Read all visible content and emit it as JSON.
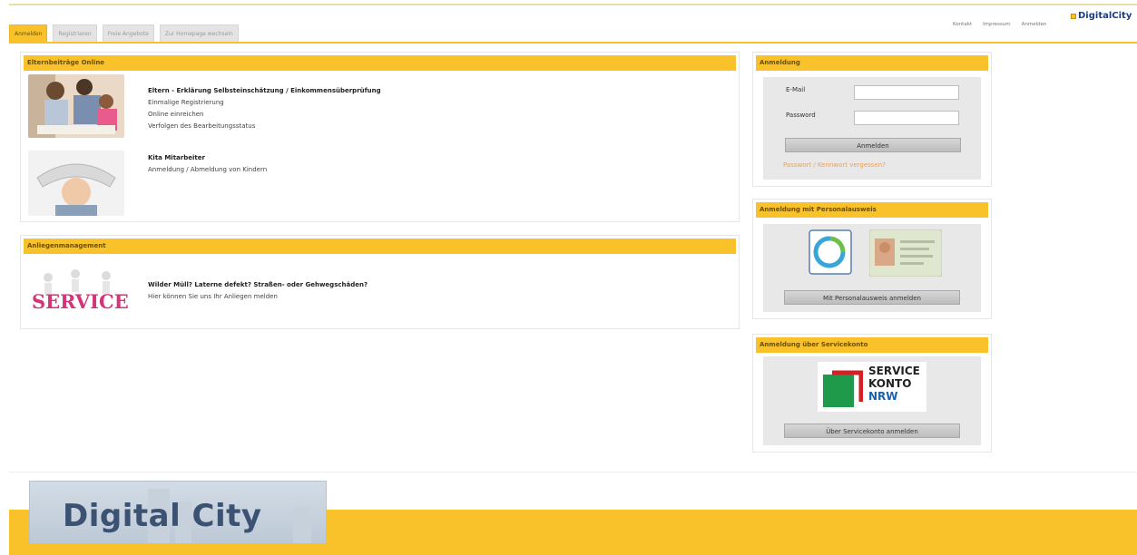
{
  "tabs": [
    {
      "label": "Anmelden",
      "active": true
    },
    {
      "label": "Registrieren",
      "active": false
    },
    {
      "label": "Freie Angebote",
      "active": false
    },
    {
      "label": "Zur Homepage wechseln",
      "active": false
    }
  ],
  "top_links": [
    "Kontakt",
    "Impressum",
    "Anmelden"
  ],
  "brand": "DigitalCity",
  "eltern_panel": {
    "title": "Elternbeiträge Online",
    "item1": {
      "title": "Eltern - Erklärung Selbsteinschätzung / Einkommensüberprüfung",
      "lines": [
        "Einmalige Registrierung",
        "Online einreichen",
        "Verfolgen des Bearbeitungsstatus"
      ]
    },
    "item2": {
      "title": "Kita Mitarbeiter",
      "lines": [
        "Anmeldung / Abmeldung von Kindern"
      ]
    }
  },
  "anliegen_panel": {
    "title": "Anliegenmanagement",
    "item": {
      "title": "Wilder Müll? Laterne defekt? Straßen- oder Gehwegschäden?",
      "lines": [
        "Hier können Sie uns Ihr Anliegen melden"
      ],
      "image_text": "SERVICE"
    }
  },
  "login_panel": {
    "title": "Anmeldung",
    "email_label": "E-Mail",
    "password_label": "Password",
    "email_value": "",
    "password_value": "",
    "submit_label": "Anmelden",
    "forgot_label": "Passwort / Kennwort vergessen?"
  },
  "ausweis_panel": {
    "title": "Anmeldung mit Personalausweis",
    "button_label": "Mit Personalausweis anmelden"
  },
  "servicekonto_panel": {
    "title": "Anmeldung über Servicekonto",
    "logo_lines": [
      "SERVICE",
      "KONTO",
      "NRW"
    ],
    "button_label": "Über Servicekonto anmelden"
  },
  "footer": {
    "logo_text": "Digital City"
  },
  "colors": {
    "accent": "#f9c22a",
    "brand_blue": "#1a3c8b"
  }
}
